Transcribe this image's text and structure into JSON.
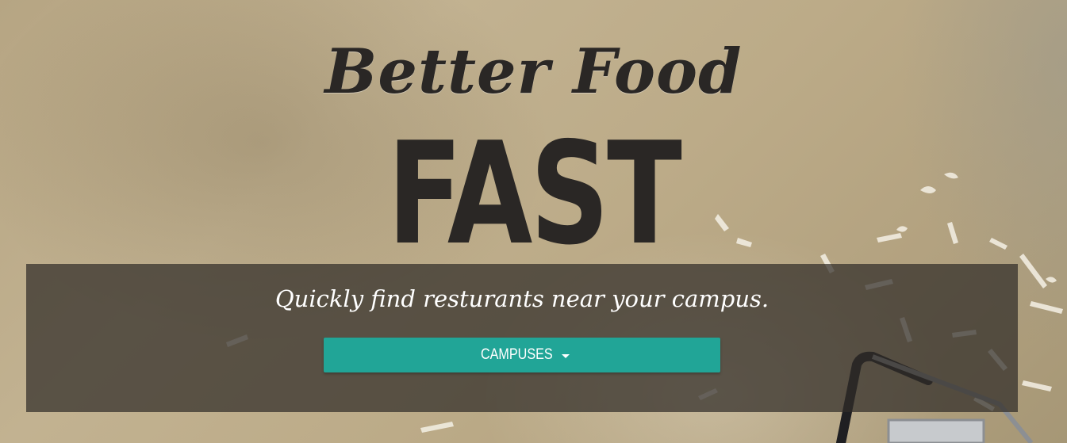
{
  "hero": {
    "script_title": "Better Food",
    "big_title": "FAST",
    "tagline": "Quickly find resturants near your campus.",
    "campuses_button": {
      "label": "CAMPUSES",
      "icon": "caret-down-icon"
    }
  },
  "colors": {
    "button": "#21a597",
    "title_text": "#2a2725",
    "overlay": "rgba(48,44,40,0.72)"
  }
}
